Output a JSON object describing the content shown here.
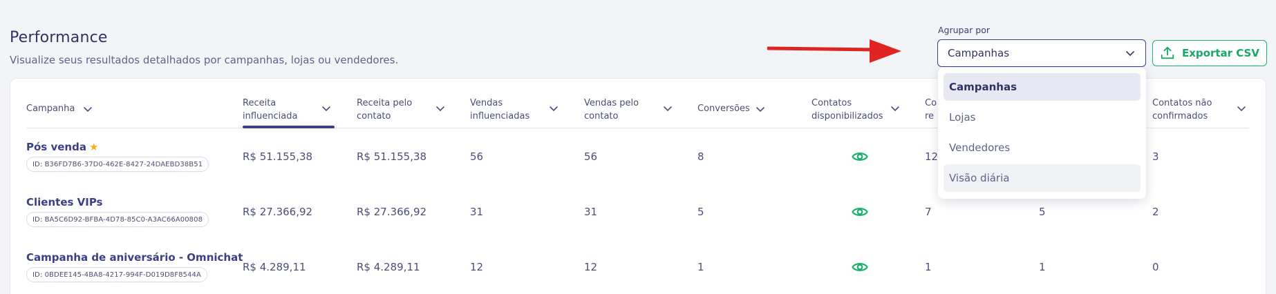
{
  "header": {
    "title": "Performance",
    "subtitle": "Visualize seus resultados detalhados por campanhas, lojas ou vendedores."
  },
  "group_by": {
    "label": "Agrupar por",
    "selected": "Campanhas",
    "options": [
      "Campanhas",
      "Lojas",
      "Vendedores",
      "Visão diária"
    ]
  },
  "export_button": {
    "label": "Exportar CSV"
  },
  "table": {
    "columns": [
      [
        "Campanha"
      ],
      [
        "Receita",
        "influenciada"
      ],
      [
        "Receita pelo",
        "contato"
      ],
      [
        "Vendas",
        "influenciadas"
      ],
      [
        "Vendas pelo",
        "contato"
      ],
      [
        "Conversões"
      ],
      [
        "Contatos",
        "disponibilizados"
      ],
      [
        "Co",
        "re"
      ],
      [
        "Contatos não",
        "confirmados"
      ]
    ],
    "rows": [
      {
        "name": "Pós venda",
        "id": "ID: B36FD7B6-37D0-462E-8427-24DAEBD38B51",
        "receita_influenciada": "R$ 51.155,38",
        "receita_contato": "R$ 51.155,38",
        "vendas_influenciadas": "56",
        "vendas_contato": "56",
        "conversoes": "8",
        "col8": "12",
        "col9": "",
        "nao_confirmados": "3"
      },
      {
        "name": "Clientes VIPs",
        "id": "ID: BA5C6D92-BFBA-4D78-85C0-A3AC66A00808",
        "receita_influenciada": "R$ 27.366,92",
        "receita_contato": "R$ 27.366,92",
        "vendas_influenciadas": "31",
        "vendas_contato": "31",
        "conversoes": "5",
        "col8": "7",
        "col9": "5",
        "nao_confirmados": "2"
      },
      {
        "name": "Campanha de aniversário - Omnichat",
        "id": "ID: 0BDEE145-4BA8-4217-994F-D019D8F8544A",
        "receita_influenciada": "R$ 4.289,11",
        "receita_contato": "R$ 4.289,11",
        "vendas_influenciadas": "12",
        "vendas_contato": "12",
        "conversoes": "1",
        "col8": "1",
        "col9": "1",
        "nao_confirmados": "0"
      }
    ]
  },
  "colors": {
    "accent": "#3a3f86",
    "success": "#18b36a",
    "arrow": "#e02424",
    "star": "#f2b01e"
  },
  "icons": [
    "chevron-down-icon",
    "upload-icon",
    "eye-icon",
    "star-icon",
    "arrow-right-icon"
  ]
}
